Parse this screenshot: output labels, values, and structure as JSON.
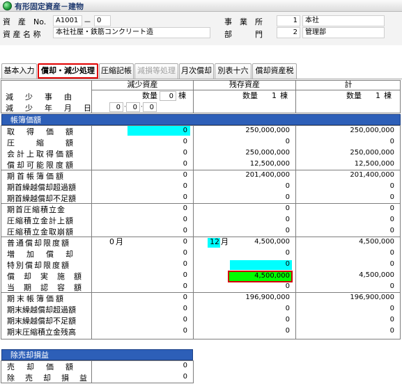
{
  "window": {
    "title": "有形固定資産－建物"
  },
  "header": {
    "asset_label": "資　産　No.",
    "asset_no": "A1001",
    "asset_sep": "－",
    "asset_sub": "0",
    "asset_name_label": "資 産 名 称",
    "asset_name": "本社社屋・鉄筋コンクリート造",
    "office_label": "事　業　所",
    "office_code": "1",
    "office_name": "本社",
    "dept_label": "部　　　門",
    "dept_code": "2",
    "dept_name": "管理部"
  },
  "tabs": [
    {
      "label": "基本入力"
    },
    {
      "label": "償却・減少処理"
    },
    {
      "label": "圧縮記帳"
    },
    {
      "label": "減損等処理"
    },
    {
      "label": "月次償却"
    },
    {
      "label": "別表十六"
    },
    {
      "label": "償却資産税"
    }
  ],
  "columns": {
    "decrease": "減少資産",
    "remaining": "残存資産",
    "total": "計"
  },
  "decrease_info": {
    "reason_label": "減　少　事　由",
    "date_label": "減　少　年　月　日",
    "qty_label": "数量",
    "qty_value": "0",
    "qty_unit": "棟",
    "date_y": "0",
    "date_m": "0",
    "date_d": "0",
    "remaining_qty_label": "数量",
    "remaining_qty_value": "1",
    "remaining_qty_unit": "棟",
    "total_qty_label": "数量",
    "total_qty_value": "1",
    "total_qty_unit": "棟"
  },
  "section_book": {
    "title": "帳簿価額"
  },
  "book_rows": [
    {
      "label": "取　得　価　額",
      "dec": "0",
      "rem": "250,000,000",
      "tot": "250,000,000"
    },
    {
      "label": "圧　　縮　　額",
      "dec": "0",
      "rem": "0",
      "tot": "0"
    },
    {
      "label": "会計上取得価額",
      "dec": "0",
      "rem": "250,000,000",
      "tot": "250,000,000"
    },
    {
      "label": "償却可能限度額",
      "dec": "0",
      "rem": "12,500,000",
      "tot": "12,500,000"
    },
    {
      "label": "期首帳簿価額",
      "dec": "0",
      "rem": "201,400,000",
      "tot": "201,400,000"
    },
    {
      "label": "期首繰越償却超過額",
      "dec": "0",
      "rem": "0",
      "tot": "0"
    },
    {
      "label": "期首繰越償却不足額",
      "dec": "0",
      "rem": "0",
      "tot": "0"
    },
    {
      "label": "期首圧縮積立金",
      "dec": "0",
      "rem": "0",
      "tot": "0"
    },
    {
      "label": "圧縮積立金計上額",
      "dec": "0",
      "rem": "0",
      "tot": "0"
    },
    {
      "label": "圧縮積立金取崩額",
      "dec": "0",
      "rem": "0",
      "tot": "0"
    },
    {
      "label": "普通償却限度額",
      "dec": "0",
      "rem": "4,500,000",
      "tot": "4,500,000"
    },
    {
      "label": "増　加　償　却",
      "dec": "0",
      "rem": "0",
      "tot": "0"
    },
    {
      "label": "特別償却限度額",
      "dec": "0",
      "rem": "0",
      "tot": "0"
    },
    {
      "label": "償　却　実　施　額",
      "dec": "0",
      "rem": "4,500,000",
      "tot": "4,500,000"
    },
    {
      "label": "当　期　認　容　額",
      "dec": "0",
      "rem": "0",
      "tot": "0"
    },
    {
      "label": "期末帳簿価額",
      "dec": "0",
      "rem": "196,900,000",
      "tot": "196,900,000"
    },
    {
      "label": "期末繰越償却超過額",
      "dec": "0",
      "rem": "0",
      "tot": "0"
    },
    {
      "label": "期末繰越償却不足額",
      "dec": "0",
      "rem": "0",
      "tot": "0"
    },
    {
      "label": "期末圧縮積立金残高",
      "dec": "0",
      "rem": "0",
      "tot": "0"
    }
  ],
  "months": {
    "dec_month": "0",
    "rem_month": "12",
    "unit": "月"
  },
  "section_sale": {
    "title": "除売却損益"
  },
  "sale_rows": [
    {
      "label": "売　却　価　額",
      "dec": "0"
    },
    {
      "label": "除　売　却　損　益",
      "dec": "0"
    }
  ],
  "colors": {
    "section_blue": "#2d5fb8",
    "highlight_cyan": "#00ffff",
    "highlight_green": "#00ff00",
    "active_tab_border": "#e00000"
  }
}
